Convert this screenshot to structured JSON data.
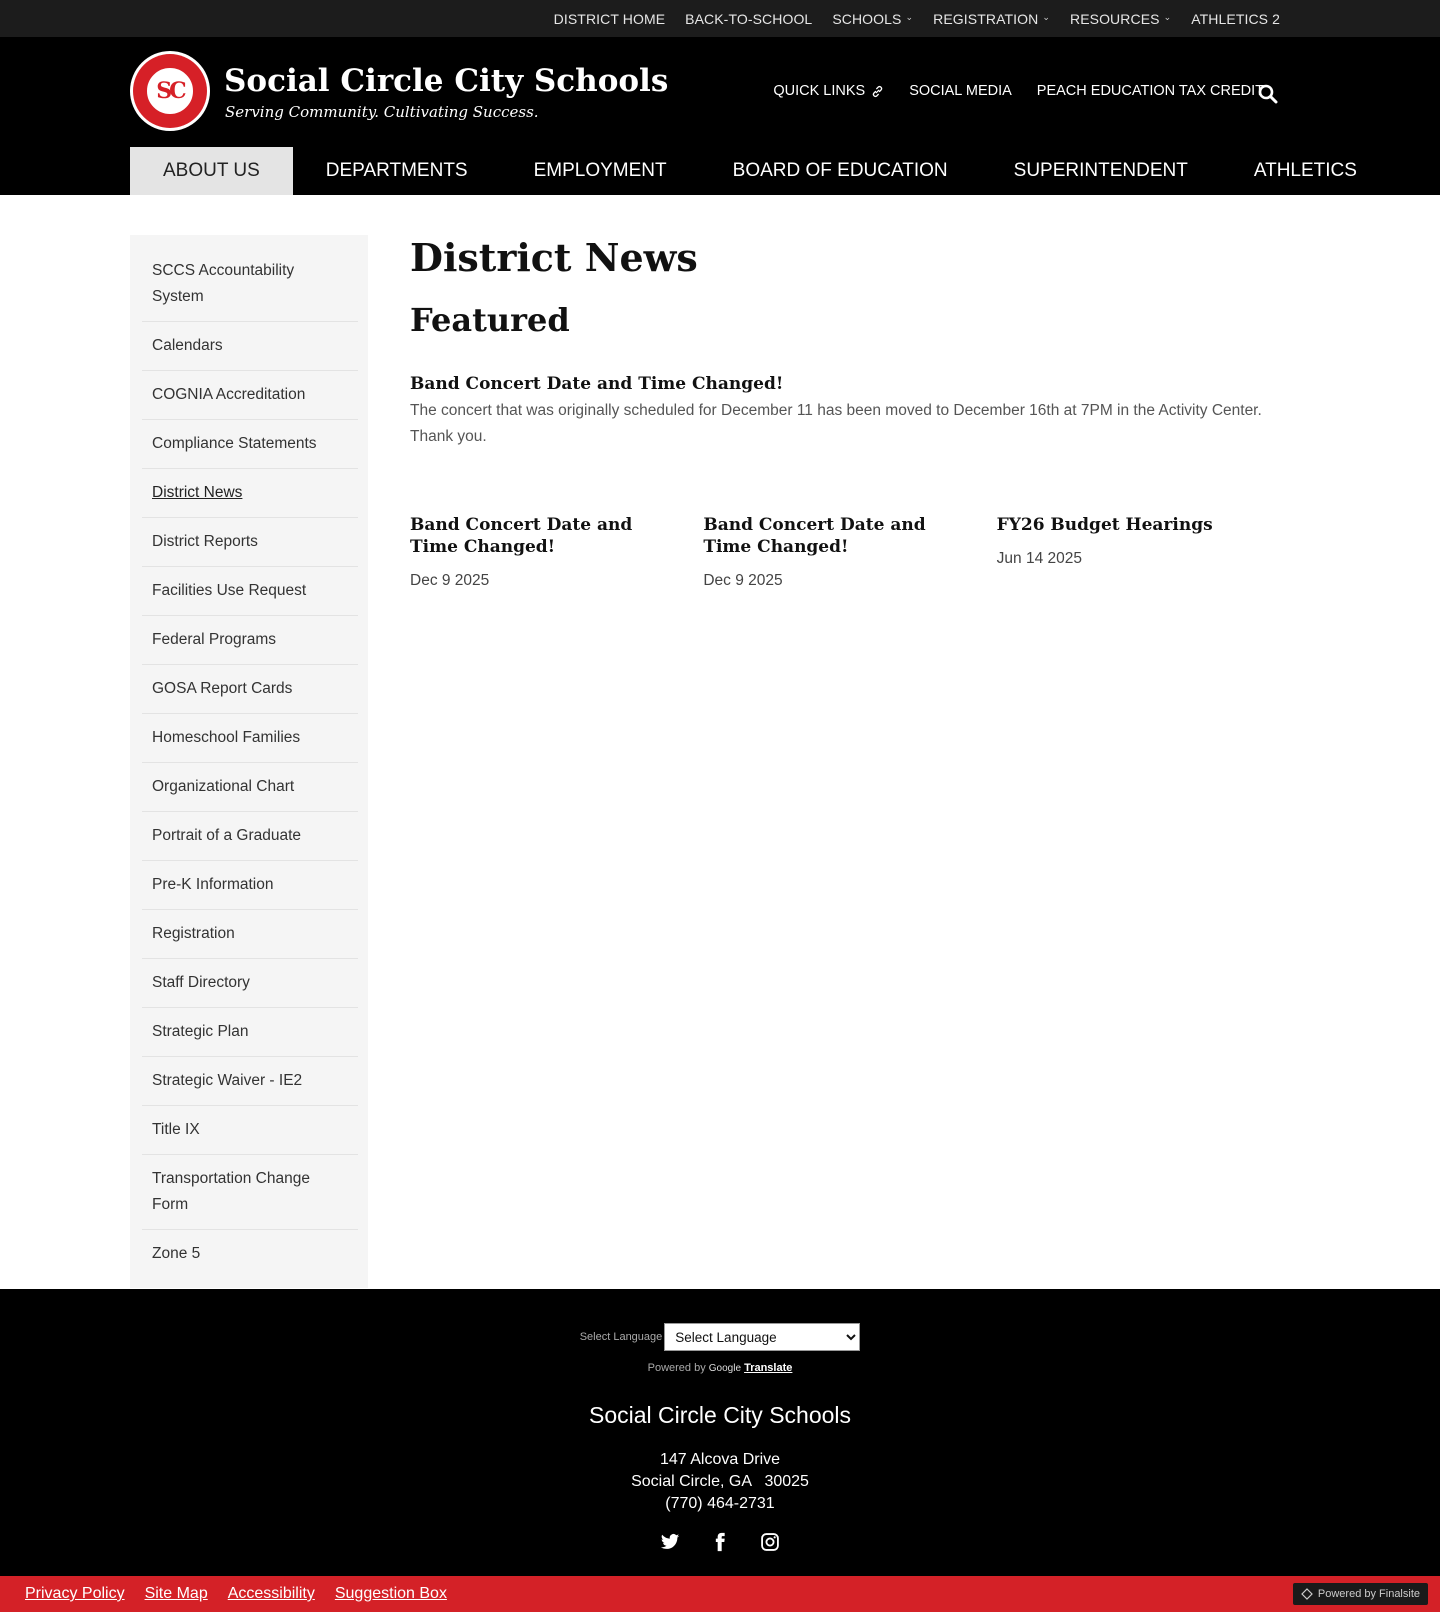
{
  "utility_nav": [
    {
      "label": "DISTRICT HOME",
      "dropdown": false
    },
    {
      "label": "BACK-TO-SCHOOL",
      "dropdown": false
    },
    {
      "label": "SCHOOLS",
      "dropdown": true
    },
    {
      "label": "REGISTRATION",
      "dropdown": true
    },
    {
      "label": "RESOURCES",
      "dropdown": true
    },
    {
      "label": "ATHLETICS 2",
      "dropdown": false
    }
  ],
  "header": {
    "logo_text": "SOCIAL CIRCLE CITY SCHOOLS",
    "logo_monogram": "SC",
    "title": "Social Circle City Schools",
    "tagline": "Serving Community. Cultivating Success.",
    "links": [
      "QUICK LINKS",
      "SOCIAL MEDIA",
      "PEACH EDUCATION TAX CREDIT"
    ]
  },
  "main_nav": [
    {
      "label": "ABOUT US",
      "active": true
    },
    {
      "label": "DEPARTMENTS",
      "active": false
    },
    {
      "label": "EMPLOYMENT",
      "active": false
    },
    {
      "label": "BOARD OF EDUCATION",
      "active": false
    },
    {
      "label": "SUPERINTENDENT",
      "active": false
    },
    {
      "label": "ATHLETICS",
      "active": false
    }
  ],
  "sidebar": {
    "items": [
      "SCCS Accountability System",
      "Calendars",
      "COGNIA Accreditation",
      "Compliance Statements",
      "District News",
      "District Reports",
      "Facilities Use Request",
      "Federal Programs",
      "GOSA Report Cards",
      "Homeschool Families",
      "Organizational Chart",
      "Portrait of a Graduate",
      "Pre-K Information",
      "Registration",
      "Staff Directory",
      "Strategic Plan",
      "Strategic Waiver - IE2",
      "Title IX",
      "Transportation Change Form",
      "Zone 5"
    ],
    "current_index": 4
  },
  "content": {
    "page_title": "District News",
    "section_title": "Featured",
    "featured": {
      "title": "Band Concert Date and Time Changed!",
      "body": "The concert that was originally scheduled for December 11 has been moved to December 16th at 7PM in the Activity Center. Thank you."
    },
    "cards": [
      {
        "title": "Band Concert Date and Time Changed!",
        "date": "Dec 9 2025"
      },
      {
        "title": "Band Concert Date and Time Changed!",
        "date": "Dec 9 2025"
      },
      {
        "title": "FY26 Budget Hearings",
        "date": "Jun 14 2025"
      }
    ]
  },
  "footer": {
    "translate_label": "Select Language",
    "language_selected": "Select Language",
    "powered_by": "Powered by",
    "google": "Google",
    "translate": "Translate",
    "name": "Social Circle City Schools",
    "address_line1": "147 Alcova Drive",
    "address_line2": "Social Circle, GA   30025",
    "phone": "(770) 464-2731",
    "socials": [
      "twitter-icon",
      "facebook-icon",
      "instagram-icon"
    ]
  },
  "bottom_bar": {
    "links": [
      "Privacy Policy",
      "Site Map",
      "Accessibility",
      "Suggestion Box"
    ],
    "powered": "Powered by Finalsite"
  },
  "colors": {
    "accent_red": "#d42127",
    "header_bg": "#000000",
    "utility_bg": "#1c1c1c",
    "active_nav_bg": "#e4e4e4",
    "sidebar_bg": "#f5f5f5"
  }
}
